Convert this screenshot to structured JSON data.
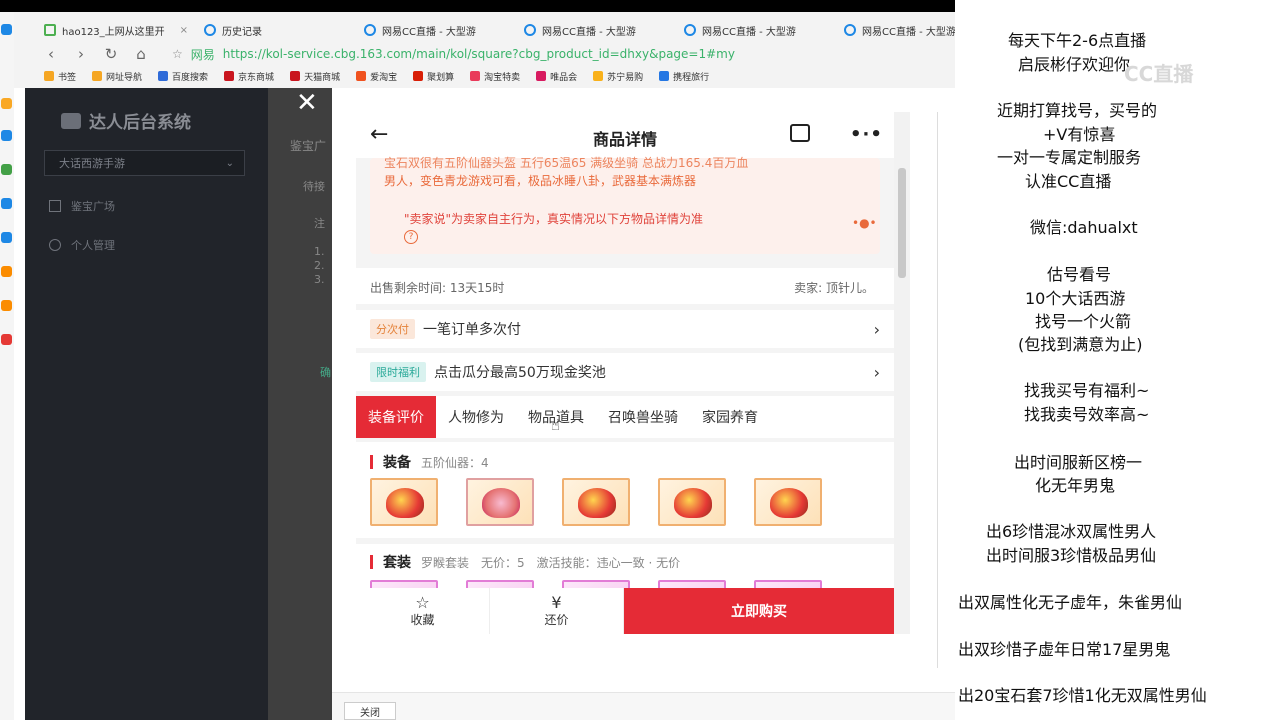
{
  "browser": {
    "tabs": [
      {
        "label": "hao123_上网从这里开"
      },
      {
        "label": "历史记录"
      },
      {
        "label": "网易CC直播 - 大型游"
      },
      {
        "label": "网易CC直播 - 大型游"
      },
      {
        "label": "网易CC直播 - 大型游"
      },
      {
        "label": "网易CC直播 - 大型游"
      }
    ],
    "site_label": "网易",
    "url": "https://kol-service.cbg.163.com/main/kol/square?cbg_product_id=dhxy&page=1#my",
    "bookmarks": [
      "书签",
      "网址导航",
      "百度搜索",
      "京东商城",
      "天猫商城",
      "爱淘宝",
      "聚划算",
      "淘宝特卖",
      "唯品会",
      "苏宁易购",
      "携程旅行"
    ]
  },
  "sidebar": {
    "title": "达人后台系统",
    "game_select": "大话西游手游",
    "items": [
      {
        "label": "鉴宝广场"
      },
      {
        "label": "个人管理"
      }
    ]
  },
  "main_bg": {
    "crumb": "鉴宝广",
    "tab": "待接",
    "note": "注",
    "list": [
      "1.",
      "2.",
      "3."
    ],
    "btn": "确"
  },
  "mobile": {
    "title": "商品详情",
    "notice_top": "宝石双很有五阶仙器头盔 五行65温65 满级坐骑 总战力165.4百万血",
    "notice_line": "男人，变色青龙游戏可看，极品冰睡八卦，武器基本满炼器",
    "notice_disclaimer": "\"卖家说\"为卖家自主行为，真实情况以下方物品详情为准",
    "sale_time": "出售剩余时间: 13天15时",
    "seller": "卖家: 顶针儿。",
    "row1": {
      "tag": "分次付",
      "text": "一笔订单多次付"
    },
    "row2": {
      "tag": "限时福利",
      "text": "点击瓜分最高50万现金奖池"
    },
    "tabs": [
      "装备评价",
      "人物修为",
      "物品道具",
      "召唤兽坐骑",
      "家园养育"
    ],
    "equip_title": "装备",
    "equip_sub": "五阶仙器：4",
    "suit_title": "套装",
    "suit_sub": "罗睺套装　无价：5　激活技能：违心一致 · 无价",
    "bottom": {
      "fav": "收藏",
      "bargain": "还价",
      "buy": "立即购买"
    }
  },
  "dialog_footer": {
    "close": "关闭"
  },
  "overlay": {
    "lines": [
      "每天下午2-6点直播",
      "启辰彬仔欢迎你",
      "近期打算找号，买号的",
      "+V有惊喜",
      "一对一专属定制服务",
      "认准CC直播",
      "微信:dahualxt",
      "估号看号",
      "10个大话西游",
      "找号一个火箭",
      "(包找到满意为止)",
      "找我买号有福利~",
      "找我卖号效率高~",
      "出时间服新区榜一",
      "化无年男鬼",
      "出6珍惜混冰双属性男人",
      "出时间服3珍惜极品男仙",
      "出双属性化无子虚年，朱雀男仙",
      "出双珍惜子虚年日常17星男鬼",
      "出20宝石套7珍惜1化无双属性男仙"
    ],
    "watermark": "CC直播"
  },
  "colors": {
    "accent": "#e52b36",
    "sidebar": "#21242a",
    "notice": "#e96a3b"
  }
}
